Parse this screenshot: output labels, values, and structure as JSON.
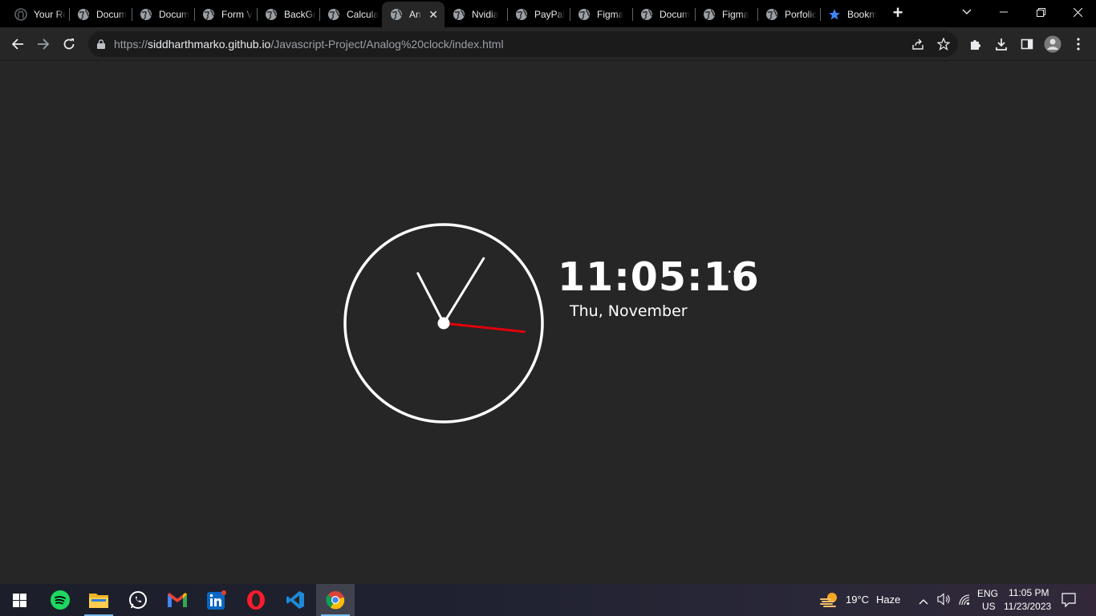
{
  "browser": {
    "tabs": [
      {
        "title": "Your Re",
        "favicon": "github-icon"
      },
      {
        "title": "Docum",
        "favicon": "globe-icon"
      },
      {
        "title": "Docum",
        "favicon": "globe-icon"
      },
      {
        "title": "Form V",
        "favicon": "globe-icon"
      },
      {
        "title": "BackGr",
        "favicon": "globe-icon"
      },
      {
        "title": "Calcula",
        "favicon": "globe-icon"
      },
      {
        "title": "An",
        "favicon": "globe-icon",
        "active": true
      },
      {
        "title": "Nvidia",
        "favicon": "globe-icon"
      },
      {
        "title": "PayPal",
        "favicon": "globe-icon"
      },
      {
        "title": "Figma",
        "favicon": "globe-icon"
      },
      {
        "title": "Docum",
        "favicon": "globe-icon"
      },
      {
        "title": "Figma",
        "favicon": "globe-icon"
      },
      {
        "title": "Porfolic",
        "favicon": "globe-icon"
      },
      {
        "title": "Bookm",
        "favicon": "star-icon"
      }
    ],
    "address": {
      "scheme": "https://",
      "host": "siddharthmarko.github.io",
      "path": "/Javascript-Project/Analog%20clock/index.html"
    }
  },
  "page": {
    "digital_time": "11:05:16",
    "ellipsis": "···",
    "date": "Thu, November",
    "clock": {
      "hour": 11,
      "minute": 5,
      "second": 16,
      "second_hand_color": "#e0000a",
      "hand_color": "#ffffff"
    }
  },
  "taskbar": {
    "apps": [
      "start-icon",
      "spotify-icon",
      "file-explorer-icon",
      "whatsapp-icon",
      "gmail-icon",
      "linkedin-icon",
      "opera-icon",
      "vscode-icon",
      "chrome-icon"
    ],
    "weather": {
      "temp": "19°C",
      "condition": "Haze"
    },
    "language": {
      "lang": "ENG",
      "region": "US"
    },
    "time": "11:05 PM",
    "date": "11/23/2023"
  }
}
